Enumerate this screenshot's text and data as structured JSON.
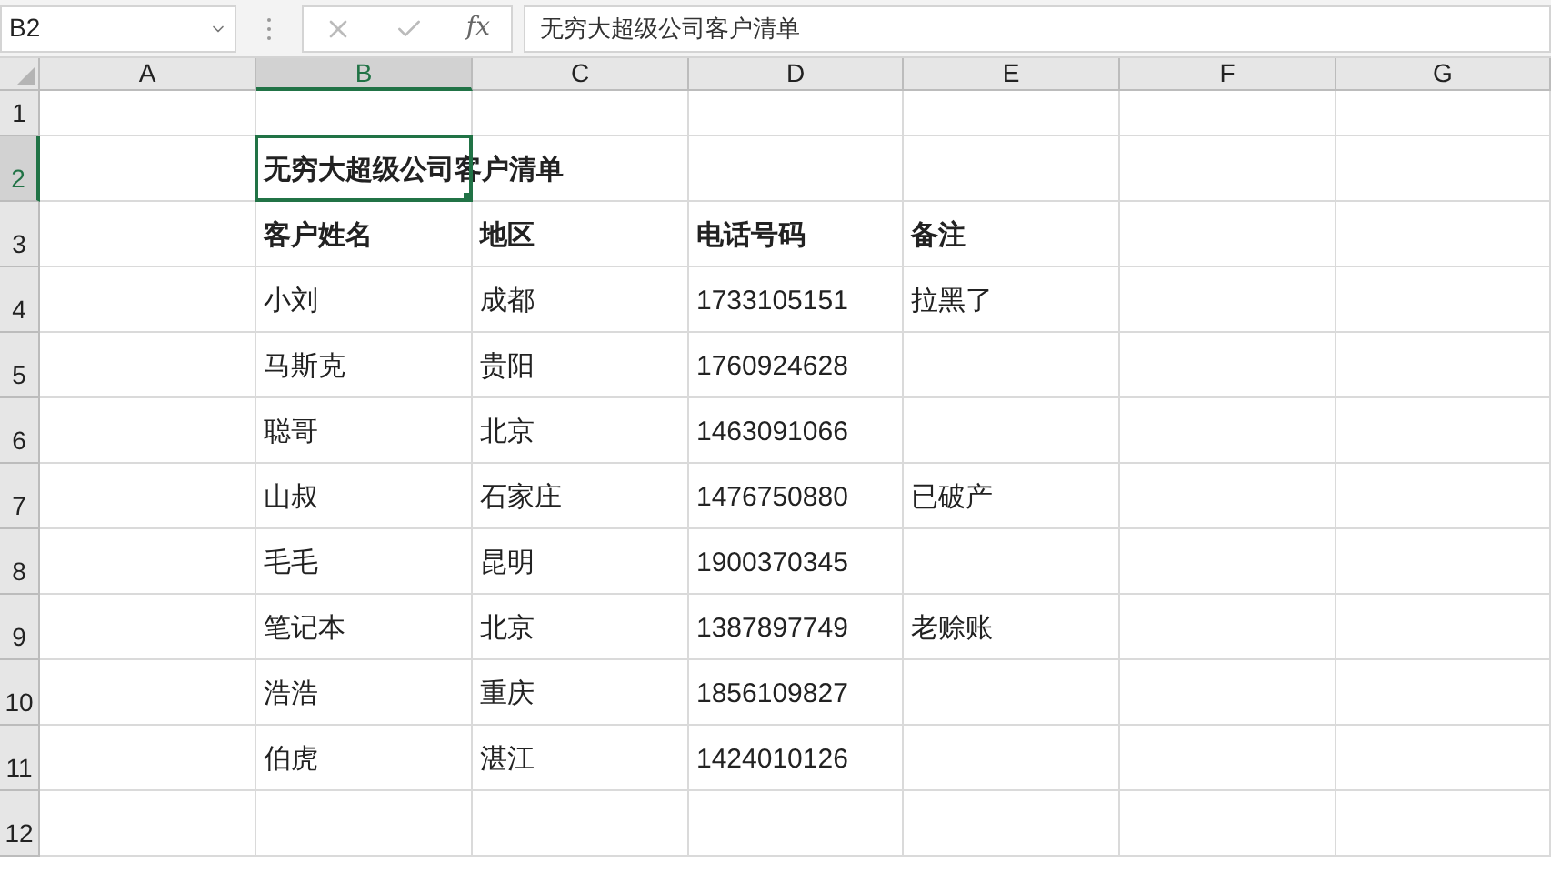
{
  "name_box": "B2",
  "fx_label": "fx",
  "formula": "无穷大超级公司客户清单",
  "columns": [
    {
      "label": "A",
      "selected": false
    },
    {
      "label": "B",
      "selected": true
    },
    {
      "label": "C",
      "selected": false
    },
    {
      "label": "D",
      "selected": false
    },
    {
      "label": "E",
      "selected": false
    },
    {
      "label": "F",
      "selected": false
    },
    {
      "label": "G",
      "selected": false
    }
  ],
  "rows": [
    {
      "number": "1",
      "selected": false,
      "cells": {}
    },
    {
      "number": "2",
      "selected": true,
      "bold": true,
      "cells": {
        "B": "无穷大超级公司客户清单"
      }
    },
    {
      "number": "3",
      "selected": false,
      "bold": true,
      "cells": {
        "B": "客户姓名",
        "C": "地区",
        "D": "电话号码",
        "E": "备注"
      }
    },
    {
      "number": "4",
      "selected": false,
      "bold": false,
      "cells": {
        "B": "小刘",
        "C": "成都",
        "D": "1733105151",
        "E": "拉黑了"
      }
    },
    {
      "number": "5",
      "selected": false,
      "bold": false,
      "cells": {
        "B": "马斯克",
        "C": "贵阳",
        "D": "1760924628"
      }
    },
    {
      "number": "6",
      "selected": false,
      "bold": false,
      "cells": {
        "B": "聪哥",
        "C": "北京",
        "D": "1463091066"
      }
    },
    {
      "number": "7",
      "selected": false,
      "bold": false,
      "cells": {
        "B": "山叔",
        "C": "石家庄",
        "D": "1476750880",
        "E": "已破产"
      }
    },
    {
      "number": "8",
      "selected": false,
      "bold": false,
      "cells": {
        "B": "毛毛",
        "C": "昆明",
        "D": "1900370345"
      }
    },
    {
      "number": "9",
      "selected": false,
      "bold": false,
      "cells": {
        "B": "笔记本",
        "C": "北京",
        "D": "1387897749",
        "E": "老赊账"
      }
    },
    {
      "number": "10",
      "selected": false,
      "bold": false,
      "cells": {
        "B": "浩浩",
        "C": "重庆",
        "D": "1856109827"
      }
    },
    {
      "number": "11",
      "selected": false,
      "bold": false,
      "cells": {
        "B": "伯虎",
        "C": "湛江",
        "D": "1424010126"
      }
    },
    {
      "number": "12",
      "selected": false,
      "cells": {}
    }
  ]
}
